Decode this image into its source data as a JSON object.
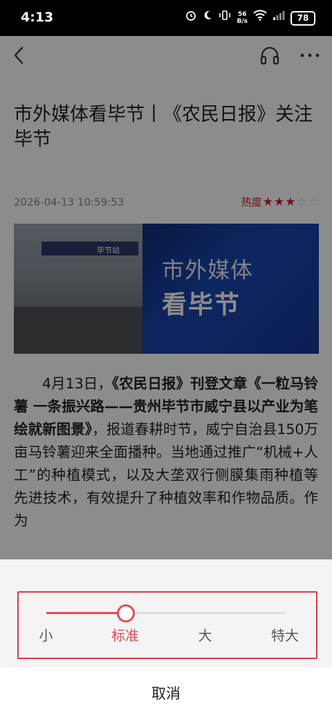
{
  "status": {
    "time": "4:13",
    "net_speed_value": "56",
    "net_speed_unit": "B/s",
    "battery": "78",
    "icons": [
      "alarm-icon",
      "moon-icon",
      "vibrate-icon",
      "wifi-icon",
      "signal-icon"
    ]
  },
  "nav": {
    "back_icon": "back-arrow-icon",
    "listen_icon": "headphones-icon",
    "more_icon": "more-icon"
  },
  "article": {
    "title": "市外媒体看毕节丨《农民日报》关注毕节",
    "date": "2026-04-13 10:59:53",
    "heat_label": "热度",
    "heat_rating": 3,
    "heat_max": 5,
    "banner": {
      "line1": "市外媒体",
      "line2": "看毕节",
      "sign_text": "毕节站"
    },
    "body_segments": [
      {
        "text": "4月13日，",
        "bold": false
      },
      {
        "text": "《农民日报》刊登文章《一粒马铃薯 一条振兴路——贵州毕节市威宁县以产业为笔绘就新图景》",
        "bold": true
      },
      {
        "text": "，报道春耕时节，威宁自治县150万亩马铃薯迎来全面播种。当地通过推广“机械+人工”的种植模式，以及大垄双行侧膜集雨种植等先进技术，有效提升了种植效率和作物品质。作为",
        "bold": false
      }
    ]
  },
  "font_size_sheet": {
    "options": [
      "小",
      "标准",
      "大",
      "特大"
    ],
    "selected_index": 1,
    "cancel_label": "取消",
    "accent_color": "#e24a55",
    "highlight_border_color": "#d63b44"
  }
}
